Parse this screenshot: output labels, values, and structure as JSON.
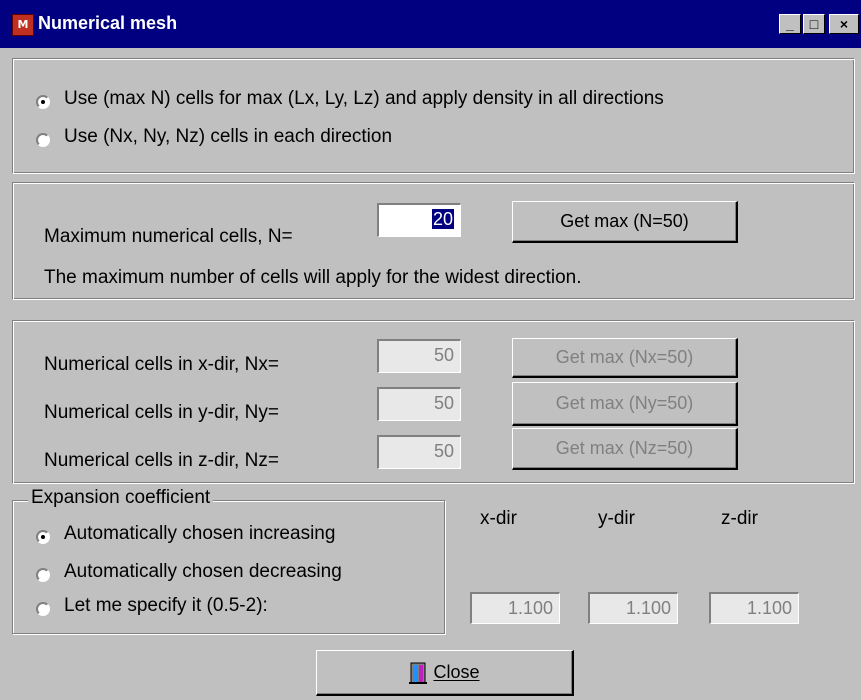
{
  "window": {
    "title": "Numerical mesh",
    "app_icon_text": "M",
    "minimize_glyph": "_",
    "maximize_glyph": "□",
    "close_glyph": "×"
  },
  "mode": {
    "option1_label": "Use (max N) cells for max (Lx, Ly, Lz) and apply density in all directions",
    "option2_label": "Use (Nx, Ny, Nz) cells in each direction",
    "selected": "option1"
  },
  "max_cells": {
    "label": "Maximum numerical cells, N=",
    "value": "20",
    "getmax_label": "Get max (N=50)",
    "note": "The maximum number of cells will apply for the widest direction."
  },
  "directional": {
    "rows": [
      {
        "label": "Numerical cells in x-dir, Nx=",
        "value": "50",
        "button": "Get max (Nx=50)"
      },
      {
        "label": "Numerical cells in y-dir, Ny=",
        "value": "50",
        "button": "Get max (Ny=50)"
      },
      {
        "label": "Numerical cells in z-dir, Nz=",
        "value": "50",
        "button": "Get max (Nz=50)"
      }
    ]
  },
  "expansion": {
    "legend": "Expansion coefficient",
    "options": [
      {
        "label": "Automatically chosen increasing"
      },
      {
        "label": "Automatically chosen decreasing"
      },
      {
        "label": "Let me specify it (0.5-2):"
      }
    ],
    "selected_index": 0,
    "columns": [
      "x-dir",
      "y-dir",
      "z-dir"
    ],
    "values": [
      "1.100",
      "1.100",
      "1.100"
    ]
  },
  "footer": {
    "close_label": "Close"
  },
  "colors": {
    "titlebar": "#000080",
    "face": "#c0c0c0",
    "disabled_text": "#808080"
  }
}
